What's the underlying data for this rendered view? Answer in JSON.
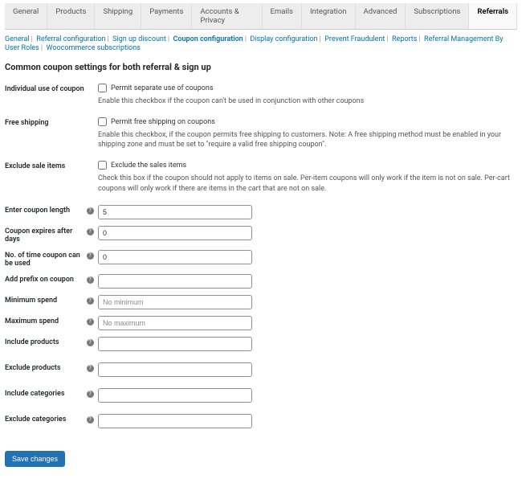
{
  "tabs": {
    "general": "General",
    "products": "Products",
    "shipping": "Shipping",
    "payments": "Payments",
    "accounts_privacy": "Accounts & Privacy",
    "emails": "Emails",
    "integration": "Integration",
    "advanced": "Advanced",
    "subscriptions": "Subscriptions",
    "referrals": "Referrals"
  },
  "subnav": {
    "general": "General",
    "referral_configuration": "Referral configuration",
    "signup_discount": "Sign up discount",
    "coupon_configuration": "Coupon configuration",
    "display_configuration": "Display configuration",
    "prevent_fraudulent": "Prevent Fraudulent",
    "reports": "Reports",
    "referral_management_by_roles": "Referral Management By User Roles",
    "woocommerce_subscriptions": "Woocommerce subscriptions"
  },
  "section": {
    "title": "Common coupon settings for both referral & sign up"
  },
  "labels": {
    "individual_use": "Individual use of coupon",
    "free_shipping": "Free shipping",
    "exclude_sale_items": "Exclude sale items",
    "coupon_length": "Enter coupon length",
    "coupon_expires": "Coupon expires after days",
    "times_used": "No. of time coupon can be used",
    "add_prefix": "Add prefix on coupon",
    "min_spend": "Minimum spend",
    "max_spend": "Maximum spend",
    "include_products": "Include products",
    "exclude_products": "Exclude products",
    "include_categories": "Include categories",
    "exclude_categories": "Exclude categories"
  },
  "checkboxes": {
    "individual_use_label": "Permit separate use of coupons",
    "individual_use_desc": "Enable this checkbox if the coupon can't be used in conjunction with other coupons",
    "free_shipping_label": "Permit free shipping on coupons",
    "free_shipping_desc": "Enable this checkbox, if the coupon permits free shipping to customers. Note: A free shipping method must be enabled in your shipping zone and must be set to \"require a valid free shipping coupon\".",
    "exclude_sale_items_label": "Exclude the sales items",
    "exclude_sale_items_desc": "Check this box if the coupon should not apply to items on sale. Per-item coupons will only work if the item is not on sale. Per-cart coupons will only work if there are items in the cart that are not on sale."
  },
  "values": {
    "coupon_length": "5",
    "coupon_expires": "0",
    "times_used": "0",
    "add_prefix": "",
    "min_spend": "",
    "max_spend": "",
    "include_products": "",
    "exclude_products": "",
    "include_categories": "",
    "exclude_categories": ""
  },
  "placeholders": {
    "min_spend": "No minimum",
    "max_spend": "No maximum"
  },
  "buttons": {
    "save": "Save changes"
  }
}
